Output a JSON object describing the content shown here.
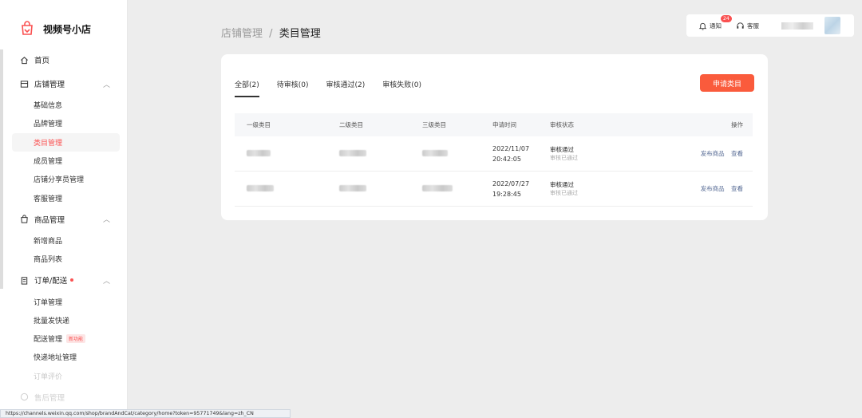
{
  "app": {
    "name": "视频号小店"
  },
  "sidebar": {
    "home": "首页",
    "groups": [
      {
        "label": "店铺管理",
        "items": [
          "基础信息",
          "品牌管理",
          "类目管理",
          "成员管理",
          "店铺分享员管理",
          "客服管理"
        ],
        "active": "类目管理"
      },
      {
        "label": "商品管理",
        "items": [
          "新增商品",
          "商品列表"
        ]
      },
      {
        "label": "订单/配送",
        "items": [
          "订单管理",
          "批量发快递",
          "配送管理",
          "快递地址管理",
          "订单评价"
        ],
        "new_tag": "新功能"
      }
    ],
    "next_group": "售后管理"
  },
  "breadcrumb": {
    "parent": "店铺管理",
    "separator": "/",
    "current": "类目管理"
  },
  "topbar": {
    "notify": "通知",
    "notify_count": "24",
    "support": "客服"
  },
  "tabs": [
    "全部(2)",
    "待审核(0)",
    "审核通过(2)",
    "审核失败(0)"
  ],
  "apply_button": "申请类目",
  "table": {
    "headers": [
      "一级类目",
      "二级类目",
      "三级类目",
      "申请时间",
      "审核状态",
      "操作"
    ],
    "rows": [
      {
        "date": "2022/11/07",
        "time": "20:42:05",
        "status": "审核通过",
        "status_sub": "审核已通过",
        "action1": "发布商品",
        "action2": "查看"
      },
      {
        "date": "2022/07/27",
        "time": "19:28:45",
        "status": "审核通过",
        "status_sub": "审核已通过",
        "action1": "发布商品",
        "action2": "查看"
      }
    ]
  },
  "status_url": "https://channels.weixin.qq.com/shop/brandAndCat/category/home?token=95771749&lang=zh_CN",
  "colors": {
    "accent": "#fa5b3c",
    "link": "#576b95",
    "active_nav": "#fa5151"
  }
}
